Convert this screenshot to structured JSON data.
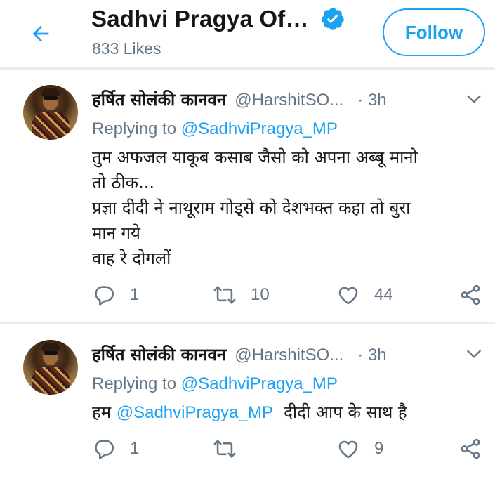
{
  "header": {
    "title": "Sadhvi Pragya Of…",
    "subtitle": "833 Likes",
    "follow_label": "Follow",
    "back_icon": "arrow-left-icon",
    "verified_icon": "verified-badge-icon"
  },
  "colors": {
    "accent": "#1da1f2",
    "text": "#14171a",
    "muted": "#657786",
    "divider": "#e6ecf0"
  },
  "tweets": [
    {
      "display_name": "हर्षित सोलंकी कानवन",
      "handle": "@HarshitSO...",
      "time": "· 3h",
      "reply_prefix": "Replying to ",
      "reply_to": "@SadhviPragya_MP",
      "text_lines": [
        "तुम अफजल याकूब कसाब जैसो को अपना अब्बू मानो",
        "तो ठीक...",
        "प्रज्ञा दीदी ने नाथूराम गोड्से को देशभक्त कहा तो बुरा",
        "मान गये",
        "वाह रे दोगलों"
      ],
      "replies": "1",
      "retweets": "10",
      "likes": "44"
    },
    {
      "display_name": "हर्षित सोलंकी कानवन",
      "handle": "@HarshitSO...",
      "time": "· 3h",
      "reply_prefix": "Replying to ",
      "reply_to": "@SadhviPragya_MP",
      "text_prefix": "हम ",
      "text_mention": "@SadhviPragya_MP",
      "text_suffix": "  दीदी आप के साथ है",
      "replies": "1",
      "retweets": "",
      "likes": "9"
    }
  ]
}
